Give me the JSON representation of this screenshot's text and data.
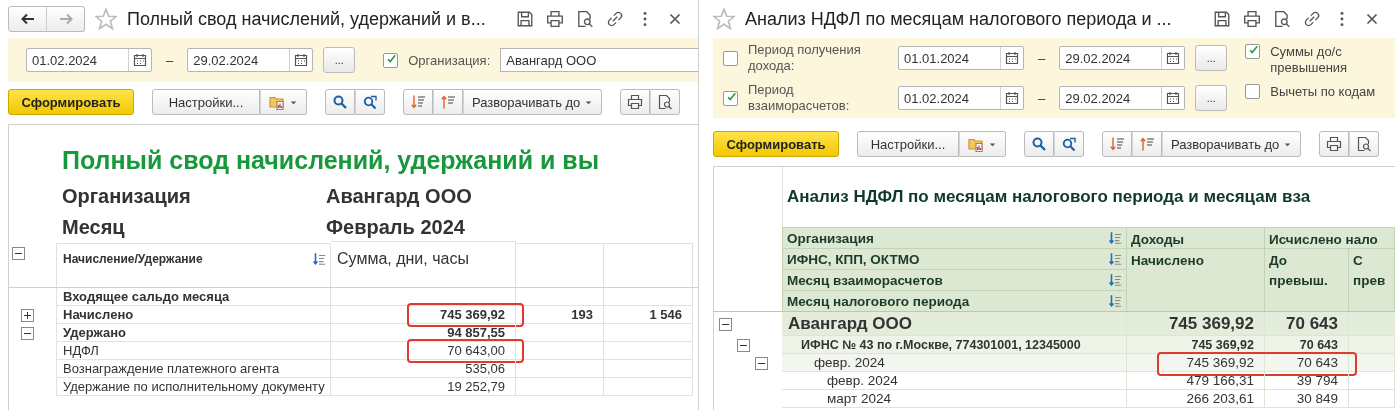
{
  "payroll_report": {
    "window": {
      "title": "Полный свод начислений, удержаний и в..."
    },
    "filters": {
      "date_from": "01.02.2024",
      "separator": "–",
      "date_to": "29.02.2024",
      "period_button": "...",
      "organization": {
        "checked": true,
        "label": "Организация:",
        "value": "Авангард ООО"
      }
    },
    "toolbar": {
      "generate": "Сформировать",
      "settings": "Настройки...",
      "expand": "Разворачивать до"
    },
    "report": {
      "title": "Полный свод начислений, удержаний и вы",
      "parameters": [
        {
          "label": "Организация",
          "value": "Авангард ООО"
        },
        {
          "label": "Месяц",
          "value": "Февраль 2024"
        }
      ],
      "columns": [
        "Начисление/Удержание",
        "Сумма, дни, часы"
      ],
      "groups_expanded": true,
      "rows": [
        {
          "label": "Входящее сальдо месяца",
          "bold": true,
          "marked": false
        },
        {
          "label": "Начислено",
          "bold": true,
          "expanded": false,
          "amount": "745 369,92",
          "column_3": "193",
          "column_4": "1 546",
          "marked": true
        },
        {
          "label": "Удержано",
          "bold": true,
          "expanded": true,
          "amount": "94 857,55",
          "marked": false,
          "children": [
            {
              "label": "НДФЛ",
              "bold": false,
              "amount": "70 643,00",
              "marked": true
            },
            {
              "label": "Вознаграждение платежного агента",
              "bold": false,
              "amount": "535,06",
              "marked": false
            },
            {
              "label": "Удержание по исполнительному документу",
              "bold": false,
              "amount": "19 252,79",
              "marked": false
            }
          ]
        }
      ]
    }
  },
  "ndfl_report": {
    "window": {
      "title": "Анализ НДФЛ по месяцам налогового периода и ..."
    },
    "filters": {
      "periods": [
        {
          "checked": false,
          "label": "Период получения дохода:",
          "date_from": "01.01.2024",
          "separator": "–",
          "date_to": "29.02.2024",
          "period_button": "..."
        },
        {
          "checked": true,
          "label": "Период взаиморасчетов:",
          "date_from": "01.02.2024",
          "separator": "–",
          "date_to": "29.02.2024",
          "period_button": "..."
        }
      ],
      "options": [
        {
          "checked": true,
          "label": "Суммы до/с превышения"
        },
        {
          "checked": false,
          "label": "Вычеты по кодам"
        }
      ]
    },
    "toolbar": {
      "generate": "Сформировать",
      "settings": "Настройки...",
      "expand": "Разворачивать до"
    },
    "report": {
      "title": "Анализ НДФЛ по месяцам налогового периода и месяцам вза",
      "groupings": [
        "Организация",
        "ИФНС, КПП, ОКТМО",
        "Месяц взаиморасчетов",
        "Месяц налогового периода"
      ],
      "income_header": "Доходы",
      "income_column": "Начислено",
      "tax_header": "Исчислено нало",
      "tax_columns": [
        "До превыш.",
        "С прев"
      ],
      "rows": [
        {
          "label": "Авангард ООО",
          "expanded": true,
          "income": "745 369,92",
          "tax_before": "70 643",
          "marked": false,
          "children": [
            {
              "label": "ИФНС № 43 по г.Москве, 774301001, 12345000",
              "expanded": true,
              "income": "745 369,92",
              "tax_before": "70 643",
              "marked": false,
              "children": [
                {
                  "label": "февр. 2024",
                  "expanded": true,
                  "income": "745 369,92",
                  "tax_before": "70 643",
                  "marked": true,
                  "children": [
                    {
                      "label": "февр. 2024",
                      "income": "479 166,31",
                      "tax_before": "39 794",
                      "marked": false
                    },
                    {
                      "label": "март 2024",
                      "income": "266 203,61",
                      "tax_before": "30 849",
                      "marked": false
                    }
                  ]
                }
              ]
            }
          ]
        }
      ]
    }
  }
}
